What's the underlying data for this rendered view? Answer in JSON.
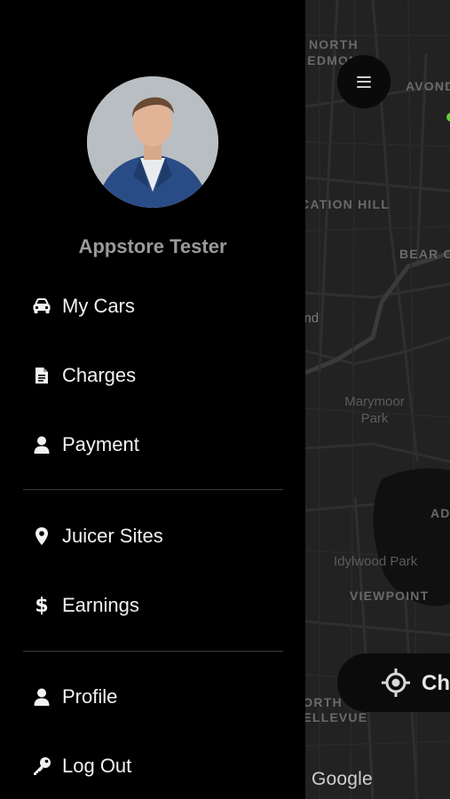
{
  "map": {
    "labels": {
      "north_redmond_1": "NORTH",
      "north_redmond_2": "REDMOND",
      "avondale": "AVOND",
      "education_hill": "EDUCATION HILL",
      "bear_creek": "BEAR C",
      "redmond": "Redmond",
      "marymoor_park_1": "Marymoor",
      "marymoor_park_2": "Park",
      "ad": "AD",
      "idylwood_park": "Idylwood Park",
      "viewpoint": "VIEWPOINT",
      "north_bellevue_1": "NORTH",
      "north_bellevue_2": "BELLEVUE"
    },
    "check_button_label": "Ch",
    "attribution": "Google"
  },
  "drawer": {
    "user_name": "Appstore Tester",
    "items": [
      {
        "label": "My Cars",
        "icon": "car-icon"
      },
      {
        "label": "Charges",
        "icon": "document-icon"
      },
      {
        "label": "Payment",
        "icon": "person-icon"
      },
      {
        "label": "Juicer Sites",
        "icon": "map-pin-icon"
      },
      {
        "label": "Earnings",
        "icon": "dollar-icon"
      },
      {
        "label": "Profile",
        "icon": "person-icon"
      },
      {
        "label": "Log Out",
        "icon": "key-icon"
      }
    ]
  },
  "colors": {
    "drawer_bg": "#000000",
    "map_bg": "#222222",
    "accent_green": "#5fcf3a"
  }
}
